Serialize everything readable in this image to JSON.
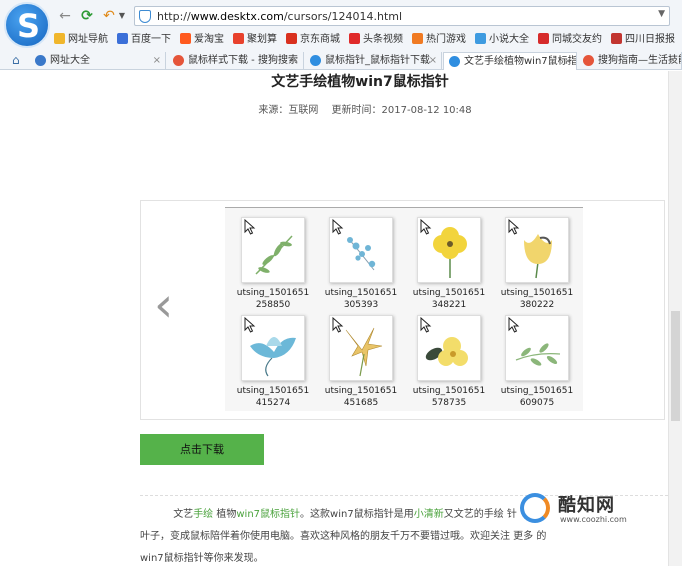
{
  "browser": {
    "url_prefix": "http://",
    "url_host": "www.desktx.com",
    "url_path": "/cursors/124014.html",
    "bookmarks": [
      {
        "label": "网址导航",
        "color": "#f0b62c"
      },
      {
        "label": "百度一下",
        "color": "#3b6fd8"
      },
      {
        "label": "爱淘宝",
        "color": "#ff5a1f"
      },
      {
        "label": "聚划算",
        "color": "#e8412c"
      },
      {
        "label": "京东商城",
        "color": "#d9301e"
      },
      {
        "label": "头条视频",
        "color": "#e02a2a"
      },
      {
        "label": "热门游戏",
        "color": "#f07a22"
      },
      {
        "label": "小说大全",
        "color": "#3e9be0"
      },
      {
        "label": "同城交友约",
        "color": "#d62b2b"
      },
      {
        "label": "四川日报报",
        "color": "#c23530"
      },
      {
        "label": "四川",
        "color": "#2a6cc0"
      }
    ],
    "tabs": [
      {
        "label": "网址大全",
        "color": "#3a78c9"
      },
      {
        "label": "鼠标样式下载 - 搜狗搜索",
        "color": "#e5553a"
      },
      {
        "label": "鼠标指针_鼠标指针下载",
        "color": "#2f8ee0"
      },
      {
        "label": "文艺手绘植物win7鼠标指",
        "color": "#2f8ee0"
      },
      {
        "label": "搜狗指南—生活技能 ",
        "color": "#e5553a"
      }
    ]
  },
  "article": {
    "title": "文艺手绘植物win7鼠标指针",
    "source": "来源：互联网",
    "updated": "更新时间：2017-08-12 10:48",
    "download_label": "点击下载",
    "prev_arrow": "‹",
    "body": {
      "p1a": "文艺",
      "p1b": "手绘",
      "p1c": " 植物",
      "p1d": "win7鼠标指针",
      "p1e": "。这款win7鼠标指针是用",
      "p1f": "小清新",
      "p1g": "又文艺的手绘 针 ",
      "p1h": "叶子，变成鼠标陪伴着你使用电脑。喜欢这种风格的朋友千万不要错过哦。欢迎关注  更多  的",
      "p1i": "win7鼠标指针等你来发现。"
    }
  },
  "gallery": [
    {
      "line1": "utsing_1501651",
      "line2": "258850",
      "plant": "branch",
      "color": "#7fb06a"
    },
    {
      "line1": "utsing_1501651",
      "line2": "305393",
      "plant": "berries",
      "color": "#6fb5d6"
    },
    {
      "line1": "utsing_1501651",
      "line2": "348221",
      "plant": "poppy",
      "color": "#f2d43c"
    },
    {
      "line1": "utsing_1501651",
      "line2": "380222",
      "plant": "tulip",
      "color": "#f1d56c"
    },
    {
      "line1": "utsing_1501651",
      "line2": "415274",
      "plant": "lotus",
      "color": "#6cb8d8"
    },
    {
      "line1": "utsing_1501651",
      "line2": "451685",
      "plant": "lily",
      "color": "#e9c468"
    },
    {
      "line1": "utsing_1501651",
      "line2": "578735",
      "plant": "bloom",
      "color": "#f3dd6a"
    },
    {
      "line1": "utsing_1501651",
      "line2": "609075",
      "plant": "leaves",
      "color": "#8bb67a"
    }
  ],
  "watermark": {
    "name": "酷知网",
    "url": "www.coozhi.com"
  }
}
